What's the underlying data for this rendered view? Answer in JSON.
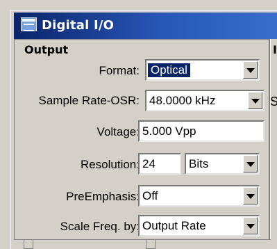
{
  "window": {
    "title": "Digital I/O",
    "icon": "window-icon"
  },
  "panel": {
    "section_title": "Output",
    "adjacent_section_title": "I",
    "adjacent_label": "S"
  },
  "format": {
    "label": "Format:",
    "value": "Optical"
  },
  "sample_rate": {
    "label": "Sample Rate-OSR:",
    "value": "48.0000 kHz"
  },
  "voltage": {
    "label": "Voltage:",
    "value": "5.000    Vpp"
  },
  "resolution": {
    "label": "Resolution:",
    "value": "24",
    "unit": "Bits"
  },
  "preemphasis": {
    "label": "PreEmphasis:",
    "value": "Off"
  },
  "scale_freq": {
    "label": "Scale Freq. by:",
    "value": "Output Rate"
  },
  "colors": {
    "titlebar_start": "#0a246a",
    "titlebar_end": "#3a6ed0",
    "selection": "#0a246a",
    "window_bg": "#d4d0c8"
  }
}
